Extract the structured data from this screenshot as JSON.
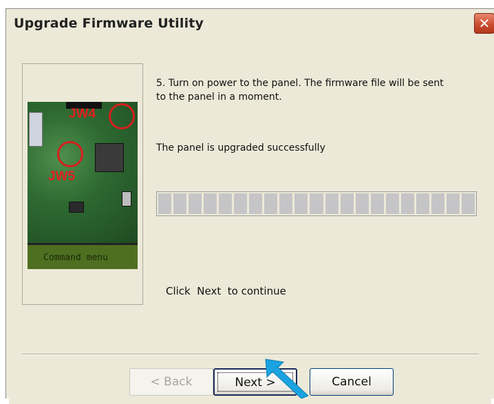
{
  "window": {
    "title": "Upgrade Firmware Utility",
    "close_glyph": "✕"
  },
  "step": {
    "instruction_line1": "5. Turn on power to the panel. The firmware file will be sent",
    "instruction_line2": "to the panel in a moment.",
    "status": "The panel is upgraded successfully",
    "continue_hint": "Click  Next  to continue"
  },
  "progress": {
    "segments": 21,
    "value": 1.0
  },
  "image": {
    "jw4_label": "JW4",
    "jw5_label": "JW5",
    "lcd_text": "Command menu"
  },
  "buttons": {
    "back_label": "< Back",
    "next_label": "Next >",
    "cancel_label": "Cancel"
  },
  "colors": {
    "dialog_bg": "#ece9d8",
    "progress_segment": "#c5c5c7",
    "close_red": "#c94a2c",
    "annotation_red": "#e02020",
    "pointer_blue": "#1aa3e0"
  },
  "icons": {
    "close": "close-icon",
    "pointer": "arrow-pointer-icon"
  }
}
